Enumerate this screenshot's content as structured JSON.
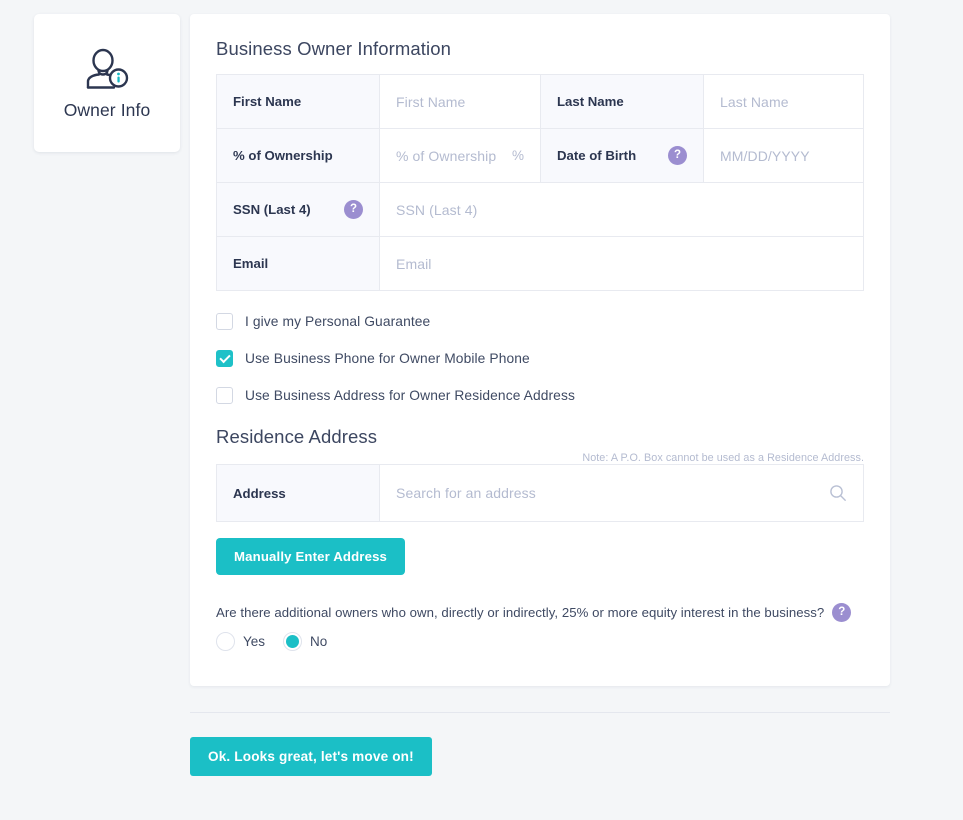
{
  "step_card": {
    "icon": "owner-info-person-icon",
    "label": "Owner Info"
  },
  "main": {
    "section_title": "Business Owner Information",
    "form_rows": [
      {
        "label_a": "First Name",
        "placeholder_a": "First Name",
        "label_b": "Last Name",
        "placeholder_b": "Last Name"
      },
      {
        "label_a": "% of Ownership",
        "placeholder_a": "% of Ownership",
        "suffix_a": "%",
        "label_b": "Date of Birth",
        "help_b": "?",
        "placeholder_b": "MM/DD/YYYY"
      }
    ],
    "ssn_row": {
      "label": "SSN (Last 4)",
      "help": "?",
      "placeholder": "SSN (Last 4)"
    },
    "email_row": {
      "label": "Email",
      "placeholder": "Email"
    },
    "checkboxes": [
      {
        "label": "I give my Personal Guarantee",
        "checked": false
      },
      {
        "label": "Use Business Phone for Owner Mobile Phone",
        "checked": true
      },
      {
        "label": "Use Business Address for Owner Residence Address",
        "checked": false
      }
    ],
    "residence": {
      "title": "Residence Address",
      "note": "Note: A P.O. Box cannot be used as a Residence Address.",
      "address_label": "Address",
      "address_placeholder": "Search for an address",
      "search_icon": "search-icon",
      "manual_button": "Manually Enter Address"
    },
    "owners_question": {
      "text": "Are there additional owners who own, directly or indirectly, 25% or more equity interest in the business?",
      "help": "?",
      "options": [
        {
          "label": "Yes",
          "selected": false
        },
        {
          "label": "No",
          "selected": true
        }
      ]
    }
  },
  "footer": {
    "submit_label": "Ok. Looks great, let's move on!"
  },
  "colors": {
    "accent_teal": "#1bbfc6",
    "help_purple": "#9b8ed0",
    "text_dark": "#2c3650",
    "placeholder": "#b4bbd0",
    "page_bg": "#f4f6f8"
  }
}
